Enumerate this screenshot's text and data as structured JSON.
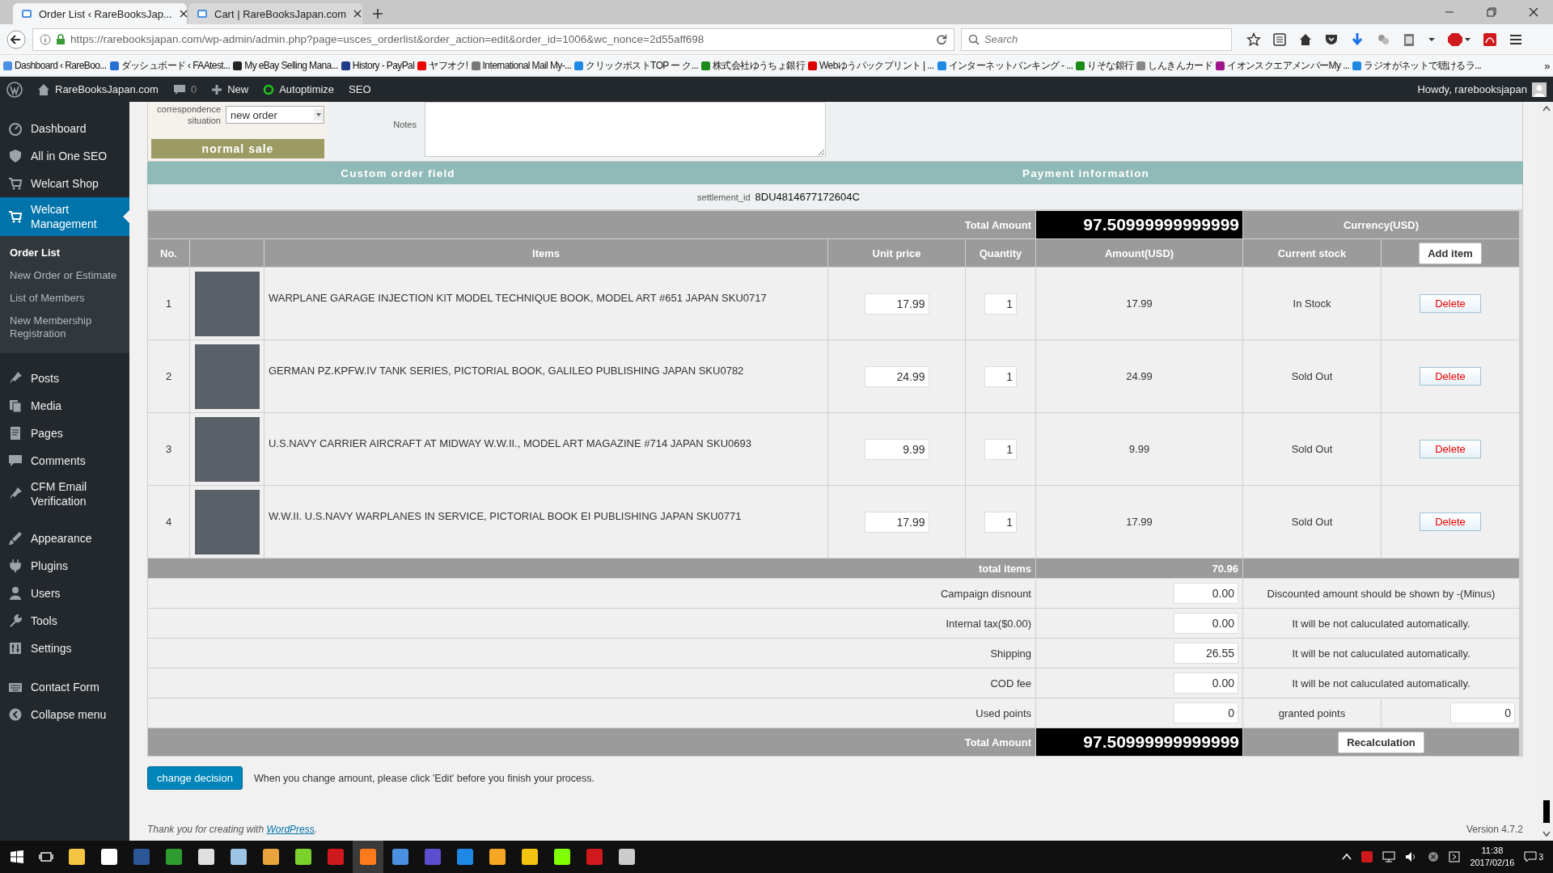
{
  "browser": {
    "tabs": [
      {
        "title": "Order List ‹ RareBooksJap...",
        "selected": true
      },
      {
        "title": "Cart | RareBooksJapan.com",
        "selected": false
      }
    ],
    "url": "https://rarebooksjapan.com/wp-admin/admin.php?page=usces_orderlist&order_action=edit&order_id=1006&wc_nonce=2d55aff698",
    "search": {
      "placeholder": "Search"
    },
    "bookmarks": [
      "Dashboard ‹ RareBoo...",
      "ダッシュボード ‹ FAAtest...",
      "My eBay Selling Mana...",
      "History - PayPal",
      "ヤフオク!",
      "International Mail My-...",
      "クリックポストTOP ー ク...",
      "株式会社ゆうちょ銀行",
      "Webゆうパックプリント | ...",
      "インターネットバンキング - ...",
      "りそな銀行",
      "しんきんカード",
      "イオンスクエアメンバーMy ...",
      "ラジオがネットで聴けるラ..."
    ],
    "bookmarks_more": "»"
  },
  "admin_bar": {
    "site": "RareBooksJapan.com",
    "comments": "0",
    "new": "New",
    "items": [
      "Autoptimize",
      "SEO"
    ],
    "greeting": "Howdy, rarebooksjapan"
  },
  "sidebar": {
    "groups": [
      [
        {
          "label": "Dashboard",
          "selected": false
        },
        {
          "label": "All in One SEO",
          "selected": false
        },
        {
          "label": "Welcart Shop",
          "selected": false
        },
        {
          "label": "Welcart Management",
          "selected": true,
          "children": [
            {
              "label": "Order List",
              "selected": true
            },
            {
              "label": "New Order or Estimate",
              "selected": false
            },
            {
              "label": "List of Members",
              "selected": false
            },
            {
              "label": "New Membership Registration",
              "selected": false
            }
          ]
        }
      ],
      [
        {
          "label": "Posts",
          "selected": false
        },
        {
          "label": "Media",
          "selected": false
        },
        {
          "label": "Pages",
          "selected": false
        },
        {
          "label": "Comments",
          "selected": false
        },
        {
          "label": "CFM Email Verification",
          "selected": false
        }
      ],
      [
        {
          "label": "Appearance",
          "selected": false
        },
        {
          "label": "Plugins",
          "selected": false
        },
        {
          "label": "Users",
          "selected": false
        },
        {
          "label": "Tools",
          "selected": false
        },
        {
          "label": "Settings",
          "selected": false
        }
      ],
      [
        {
          "label": "Contact Form",
          "selected": false
        },
        {
          "label": "Collapse menu",
          "selected": false
        }
      ]
    ]
  },
  "order_form": {
    "status_label": "correspondence situation",
    "status_value": "new order",
    "order_type": "normal sale",
    "notes_label": "Notes"
  },
  "sections": {
    "custom_order_field": "Custom order field",
    "payment_information": "Payment information"
  },
  "settlement": {
    "label": "settlement_id",
    "value": "8DU4814677172604C"
  },
  "order_table": {
    "total": {
      "label": "Total Amount",
      "value": "97.50999999999999",
      "currency": "Currency(USD)"
    },
    "columns": [
      "No.",
      "Items",
      "Unit price",
      "Quantity",
      "Amount(USD)",
      "Current stock"
    ],
    "add_item": "Add item",
    "rows": [
      {
        "no": "1",
        "title": "WARPLANE GARAGE INJECTION KIT MODEL TECHNIQUE BOOK, MODEL ART #651 JAPAN SKU0717",
        "unit_price": "17.99",
        "quantity": "1",
        "amount": "17.99",
        "stock": "In Stock",
        "delete": "Delete"
      },
      {
        "no": "2",
        "title": "GERMAN PZ.KPFW.IV TANK SERIES, PICTORIAL BOOK, GALILEO PUBLISHING JAPAN SKU0782",
        "unit_price": "24.99",
        "quantity": "1",
        "amount": "24.99",
        "stock": "Sold Out",
        "delete": "Delete"
      },
      {
        "no": "3",
        "title": "U.S.NAVY CARRIER AIRCRAFT AT MIDWAY W.W.II., MODEL ART MAGAZINE #714 JAPAN SKU0693",
        "unit_price": "9.99",
        "quantity": "1",
        "amount": "9.99",
        "stock": "Sold Out",
        "delete": "Delete"
      },
      {
        "no": "4",
        "title": "W.W.II. U.S.NAVY WARPLANES IN SERVICE, PICTORIAL BOOK EI PUBLISHING JAPAN SKU0771",
        "unit_price": "17.99",
        "quantity": "1",
        "amount": "17.99",
        "stock": "Sold Out",
        "delete": "Delete"
      }
    ],
    "total_items": {
      "label": "total items",
      "value": "70.96"
    },
    "adjustments": [
      {
        "label": "Campaign disnount",
        "value": "0.00",
        "note": "Discounted amount should be shown by -(Minus)"
      },
      {
        "label": "Internal tax($0.00)",
        "value": "0.00",
        "note": "It will be not caluculated automatically."
      },
      {
        "label": "Shipping",
        "value": "26.55",
        "note": "It will be not caluculated automatically."
      },
      {
        "label": "COD fee",
        "value": "0.00",
        "note": "It will be not caluculated automatically."
      }
    ],
    "points": {
      "used_label": "Used points",
      "used_value": "0",
      "granted_label": "granted points",
      "granted_value": "0"
    },
    "grand_total": {
      "label": "Total Amount",
      "value": "97.50999999999999",
      "button": "Recalculation"
    }
  },
  "actions": {
    "button": "change decision",
    "notice": "When you change amount, please click 'Edit' before you finish your process."
  },
  "footer": {
    "thanks": "Thank you for creating with ",
    "link": "WordPress",
    "after": ".",
    "version": "Version 4.7.2"
  },
  "taskbar": {
    "time": "11:38",
    "date": "2017/02/16",
    "notifications": "3"
  }
}
